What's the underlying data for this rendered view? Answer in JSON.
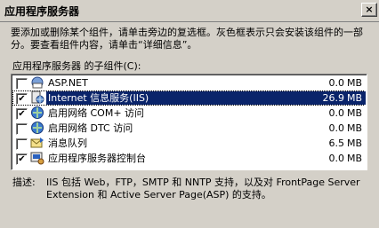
{
  "window": {
    "title": "应用程序服务器",
    "close_glyph": "×"
  },
  "instruction": "要添加或删除某个组件，请单击旁边的复选框。灰色框表示只会安装该组件的一部分。要查看组件内容，请单击“详细信息”。",
  "components_label": "应用程序服务器 的子组件(C):",
  "components": [
    {
      "name": "ASP.NET",
      "size": "0.0",
      "unit": "MB",
      "checked": false,
      "selected": false,
      "icon": "aspnet-icon"
    },
    {
      "name": "Internet 信息服务(IIS)",
      "size": "26.9",
      "unit": "MB",
      "checked": true,
      "selected": true,
      "icon": "iis-icon"
    },
    {
      "name": "启用网络 COM+ 访问",
      "size": "0.0",
      "unit": "MB",
      "checked": true,
      "selected": false,
      "icon": "com-plus-icon"
    },
    {
      "name": "启用网络 DTC 访问",
      "size": "0.0",
      "unit": "MB",
      "checked": false,
      "selected": false,
      "icon": "dtc-icon"
    },
    {
      "name": "消息队列",
      "size": "6.5",
      "unit": "MB",
      "checked": false,
      "selected": false,
      "icon": "message-queue-icon"
    },
    {
      "name": "应用程序服务器控制台",
      "size": "0.0",
      "unit": "MB",
      "checked": true,
      "selected": false,
      "icon": "console-icon"
    }
  ],
  "description": {
    "label": "描述:",
    "text": "IIS 包括 Web，FTP，SMTP 和 NNTP 支持，以及对 FrontPage Server Extension 和 Active Server Page(ASP) 的支持。"
  },
  "colors": {
    "selection": "#0a246a",
    "face": "#d4d0c8"
  }
}
